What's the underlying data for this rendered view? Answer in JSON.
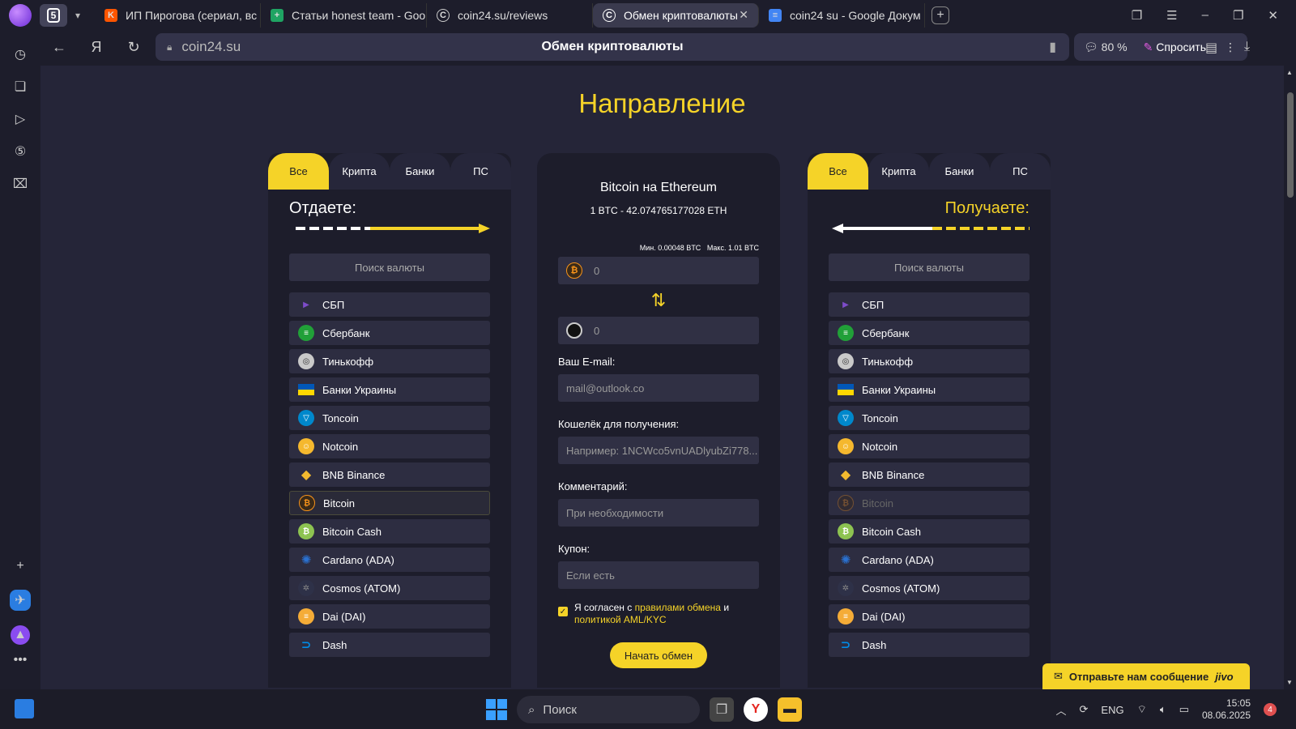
{
  "browser": {
    "tab_count": "5",
    "tabs": [
      {
        "title": "ИП Пирогова (сериал, вс",
        "icon": "kinopoisk-icon",
        "color": "#ff5500"
      },
      {
        "title": "Статьи honest team - Goo",
        "icon": "sheets-icon",
        "color": "#1fa463"
      },
      {
        "title": "coin24.su/reviews",
        "icon": "coin24-icon",
        "color": "#1d1d2b"
      },
      {
        "title": "Обмен криптовалюты",
        "icon": "coin24-icon",
        "color": "#1d1d2b"
      },
      {
        "title": "coin24 su - Google Докум",
        "icon": "docs-icon",
        "color": "#4285f4"
      }
    ],
    "domain": "coin24.su",
    "page_title": "Обмен криптовалюты",
    "zoom": "80 %",
    "ask_label": "Спросить"
  },
  "page": {
    "heading": "Направление",
    "filter_tabs": [
      "Все",
      "Крипта",
      "Банки",
      "ПС"
    ],
    "give_label": "Отдаете:",
    "receive_label": "Получаете:",
    "search_placeholder": "Поиск валюты",
    "currencies": [
      {
        "name": "СБП",
        "icon": "sbp-icon",
        "color": "#7d4cc9"
      },
      {
        "name": "Сбербанк",
        "icon": "sberbank-icon",
        "color": "#21a038"
      },
      {
        "name": "Тинькофф",
        "icon": "tinkoff-icon",
        "color": "#c9c9c9"
      },
      {
        "name": "Банки Украины",
        "icon": "ukraine-flag-icon",
        "color": "#0057b7"
      },
      {
        "name": "Toncoin",
        "icon": "toncoin-icon",
        "color": "#0088cc"
      },
      {
        "name": "Notcoin",
        "icon": "notcoin-icon",
        "color": "#f5b82e"
      },
      {
        "name": "BNB Binance",
        "icon": "bnb-icon",
        "color": "#f3ba2f"
      },
      {
        "name": "Bitcoin",
        "icon": "bitcoin-icon",
        "color": "#f7931a"
      },
      {
        "name": "Bitcoin Cash",
        "icon": "bitcoin-cash-icon",
        "color": "#8dc351"
      },
      {
        "name": "Cardano (ADA)",
        "icon": "cardano-icon",
        "color": "#2a71d0"
      },
      {
        "name": "Cosmos (ATOM)",
        "icon": "cosmos-icon",
        "color": "#2e3148"
      },
      {
        "name": "Dai (DAI)",
        "icon": "dai-icon",
        "color": "#f5ac37"
      },
      {
        "name": "Dash",
        "icon": "dash-icon",
        "color": "#008ce7"
      }
    ],
    "exchange": {
      "pair": "Bitcoin на Ethereum",
      "rate": "1 BTC - 42.074765177028 ETH",
      "min": "Мин. 0.00048 BTC",
      "max": "Макс. 1.01 BTC",
      "give_amount": "0",
      "receive_amount": "0",
      "email_label": "Ваш E-mail:",
      "email_placeholder": "mail@outlook.co",
      "wallet_label": "Кошелёк для получения:",
      "wallet_placeholder": "Например: 1NCWco5vnUADlyubZi778...",
      "comment_label": "Комментарий:",
      "comment_placeholder": "При необходимости",
      "coupon_label": "Купон:",
      "coupon_placeholder": "Если есть",
      "agree_prefix": "Я согласен с ",
      "agree_link1": "правилами обмена",
      "agree_and": " и",
      "agree_link2": "политикой AML/KYC",
      "submit": "Начать обмен"
    },
    "chat": {
      "label": "Отправьте нам сообщение",
      "brand": "jivo"
    }
  },
  "taskbar": {
    "search": "Поиск",
    "lang": "ENG",
    "time": "15:05",
    "date": "08.06.2025",
    "notifications": "4"
  },
  "colors": {
    "accent": "#f5d328"
  }
}
